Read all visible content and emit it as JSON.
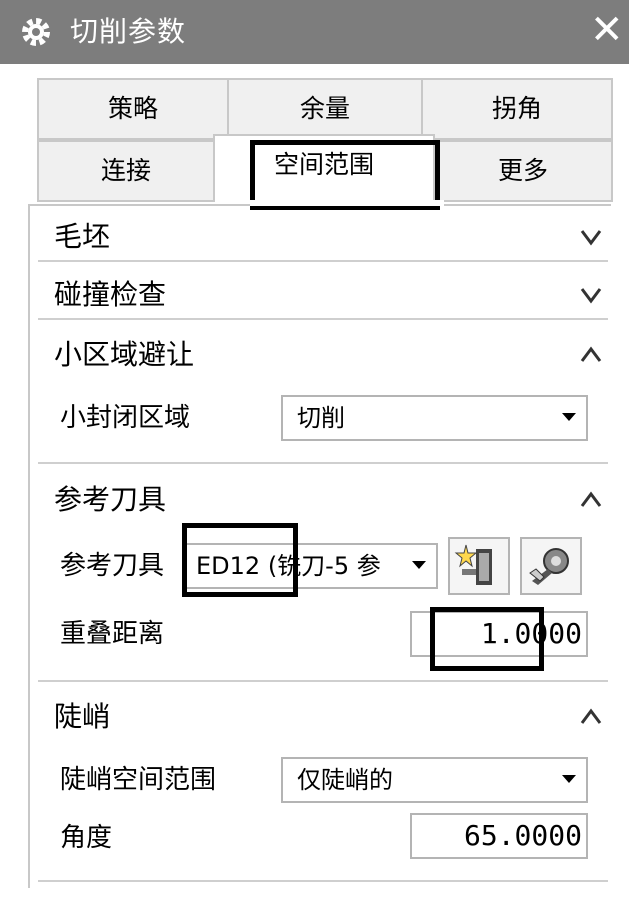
{
  "dialog": {
    "title": "切削参数",
    "close_label": "✕"
  },
  "tabs": {
    "row1": [
      "策略",
      "余量",
      "拐角"
    ],
    "row2": [
      "连接",
      "空间范围",
      "更多"
    ],
    "active": "空间范围"
  },
  "sections": {
    "blank": {
      "title": "毛坯",
      "state": "collapsed"
    },
    "collision": {
      "title": "碰撞检查",
      "state": "collapsed"
    },
    "small_area": {
      "title": "小区域避让",
      "state": "expanded",
      "closed_area_label": "小封闭区域",
      "closed_area_value": "切削"
    },
    "ref_tool": {
      "title": "参考刀具",
      "state": "expanded",
      "tool_label": "参考刀具",
      "tool_value": "ED12 (铣刀-5 参",
      "overlap_label": "重叠距离",
      "overlap_value": "1.0000"
    },
    "steep": {
      "title": "陡峭",
      "state": "expanded",
      "range_label": "陡峭空间范围",
      "range_value": "仅陡峭的",
      "angle_label": "角度",
      "angle_value": "65.0000"
    }
  },
  "icons": {
    "title": "gear-icon",
    "new_tool": "new-tool-icon",
    "edit_tool": "edit-tool-icon",
    "collapsed": "chevron-down-icon",
    "expanded": "chevron-up-icon"
  }
}
